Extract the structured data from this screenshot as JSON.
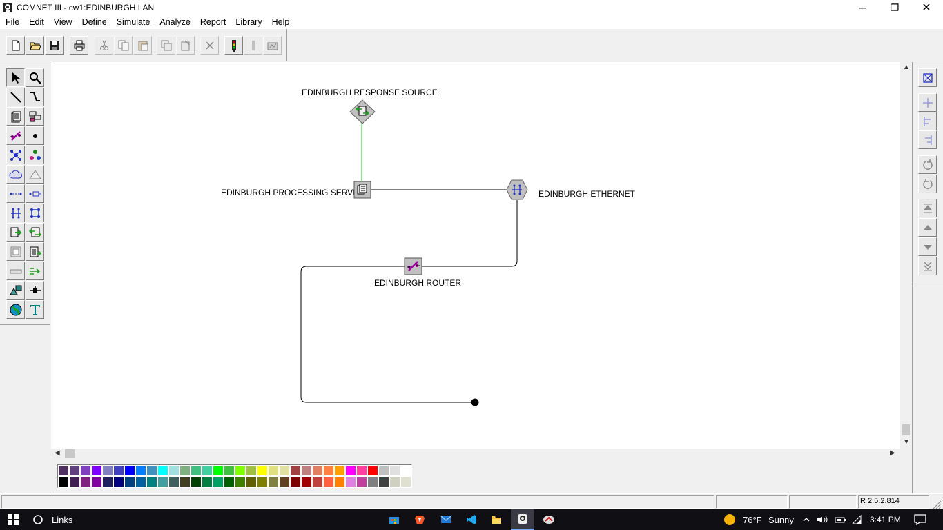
{
  "window": {
    "title": "COMNET III - cw1:EDINBURGH LAN",
    "minimize_symbol": "─",
    "maximize_symbol": "❐",
    "close_symbol": "✕"
  },
  "menu": {
    "items": [
      "File",
      "Edit",
      "View",
      "Define",
      "Simulate",
      "Analyze",
      "Report",
      "Library",
      "Help"
    ]
  },
  "toolbar": {
    "buttons": [
      {
        "icon": "new-file-icon"
      },
      {
        "icon": "open-folder-icon"
      },
      {
        "icon": "save-icon"
      },
      {
        "icon": "print-icon"
      },
      {
        "icon": "cut-icon"
      },
      {
        "icon": "copy-icon"
      },
      {
        "icon": "paste-icon"
      },
      {
        "icon": "duplicate-icon"
      },
      {
        "icon": "paste-special-icon"
      },
      {
        "icon": "delete-icon"
      },
      {
        "icon": "traffic-light-icon"
      },
      {
        "icon": "step-icon"
      },
      {
        "icon": "animate-icon"
      }
    ]
  },
  "canvas": {
    "nodes": [
      {
        "label": "EDINBURGH RESPONSE SOURCE",
        "icon": "response-source-icon"
      },
      {
        "label": "EDINBURGH PROCESSING SERVER",
        "icon": "processing-node-icon"
      },
      {
        "label": "EDINBURGH ETHERNET",
        "icon": "ethernet-link-icon"
      },
      {
        "label": "EDINBURGH ROUTER",
        "icon": "router-icon"
      }
    ],
    "colors": {
      "source_link": "#22cc22",
      "wire": "#000000",
      "node_fill": "#c0c0c0"
    }
  },
  "palette_colors": {
    "row1": [
      "#503060",
      "#604080",
      "#8040c0",
      "#8000ff",
      "#8080c0",
      "#4040c0",
      "#0000ff",
      "#0080ff",
      "#4090c0",
      "#00ffff",
      "#a0e0e0",
      "#80b080",
      "#40c080",
      "#40d0a0",
      "#00ff00",
      "#40c040",
      "#80ff00",
      "#a0c040",
      "#ffff00",
      "#e0e080",
      "#e0e0a0",
      "#a04040",
      "#c08080",
      "#e08060",
      "#ff8040",
      "#ffa000",
      "#ff00ff",
      "#ff40a0",
      "#ff0000",
      "#c0c0c0",
      "#e0e0e0",
      "#ffffff"
    ],
    "row2": [
      "#000000",
      "#402050",
      "#802080",
      "#8000a0",
      "#202060",
      "#000080",
      "#004080",
      "#0060a0",
      "#008080",
      "#40a0a0",
      "#406060",
      "#404020",
      "#004000",
      "#008040",
      "#00a060",
      "#006000",
      "#408000",
      "#606000",
      "#808000",
      "#808040",
      "#604020",
      "#800000",
      "#a00000",
      "#c04040",
      "#ff6040",
      "#ff8000",
      "#e080e0",
      "#c040a0",
      "#808080",
      "#404040",
      "#d0d0c0",
      "#e0e0d0"
    ]
  },
  "statusbar": {
    "version": "R 2.5.2.814"
  },
  "taskbar": {
    "search_label": "Links",
    "weather_temp": "76°F",
    "weather_condition": "Sunny",
    "time": "3:41 PM"
  }
}
